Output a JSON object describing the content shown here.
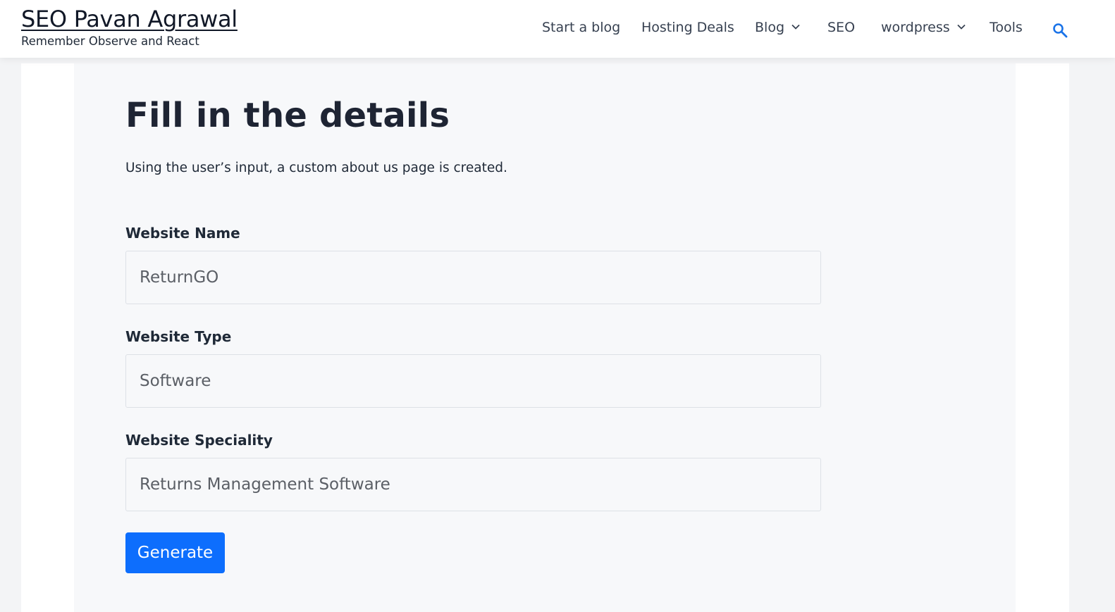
{
  "site": {
    "title": "SEO Pavan Agrawal",
    "tagline": "Remember Observe and React"
  },
  "nav": {
    "start_blog": "Start a blog",
    "hosting_deals": "Hosting Deals",
    "blog": "Blog",
    "seo": "SEO",
    "wordpress": "wordpress",
    "tools": "Tools",
    "search_icon": "search-icon",
    "accent_color": "#1a73e8"
  },
  "form": {
    "title": "Fill in the details",
    "intro": "Using the user’s input, a custom about us page is created.",
    "website_name": {
      "label": "Website Name",
      "value": "ReturnGO"
    },
    "website_type": {
      "label": "Website Type",
      "value": "Software"
    },
    "website_speciality": {
      "label": "Website Speciality",
      "value": "Returns Management Software"
    },
    "generate_label": "Generate",
    "button_color": "#0d6efd"
  }
}
